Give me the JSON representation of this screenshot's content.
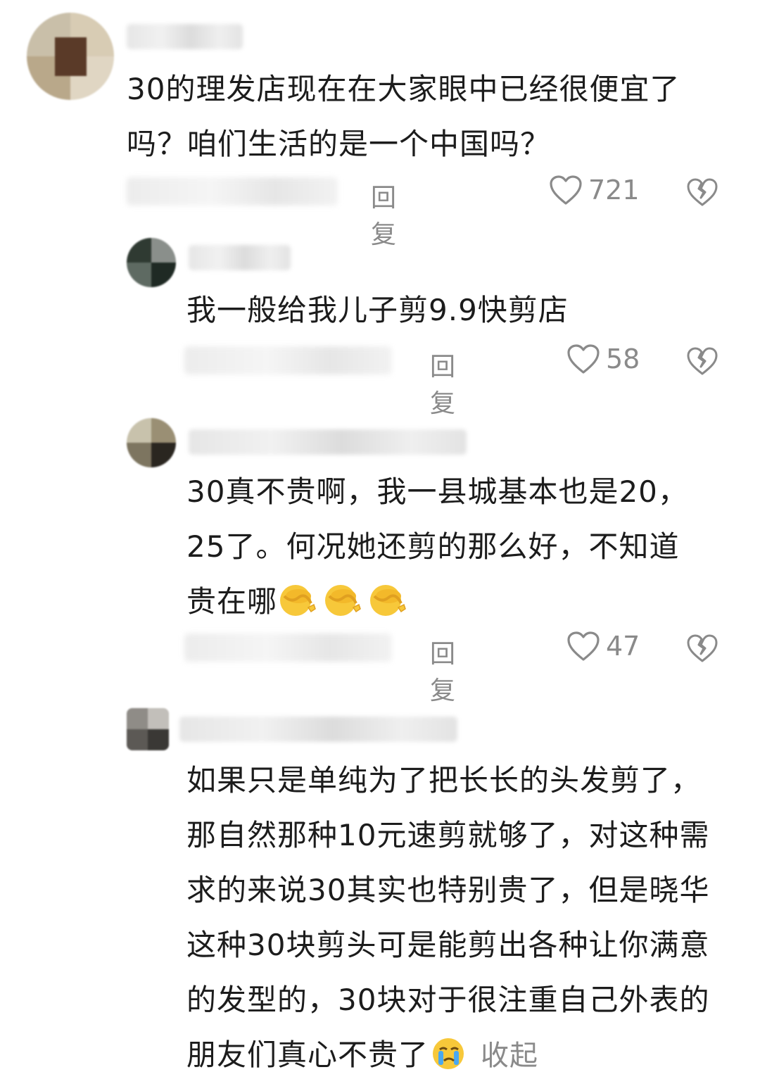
{
  "comments": [
    {
      "text": "30的理发店现在在大家眼中已经很便宜了吗？咱们生活的是一个中国吗？",
      "reply_label": "回复",
      "likes": "721"
    },
    {
      "text": "我一般给我儿子剪9.9快剪店",
      "reply_label": "回复",
      "likes": "58"
    },
    {
      "text": "30真不贵啊，我一县城基本也是20，25了。何况她还剪的那么好，不知道贵在哪",
      "reply_label": "回复",
      "likes": "47",
      "emoji_icons": [
        "facepalm-emoji",
        "facepalm-emoji",
        "facepalm-emoji"
      ]
    },
    {
      "text": "如果只是单纯为了把长长的头发剪了，那自然那种10元速剪就够了，对这种需求的来说30其实也特别贵了，但是晓华这种30块剪头可是能剪出各种让你满意的发型的，30块对于很注重自己外表的朋友们真心不贵了",
      "emoji_icon": "crying-emoji",
      "collapse_label": "收起"
    }
  ],
  "icons": {
    "like": "heart-outline-icon",
    "dislike": "broken-heart-icon"
  },
  "colors": {
    "text": "#1c1c1c",
    "meta": "#8a8a8a",
    "background": "#ffffff"
  }
}
